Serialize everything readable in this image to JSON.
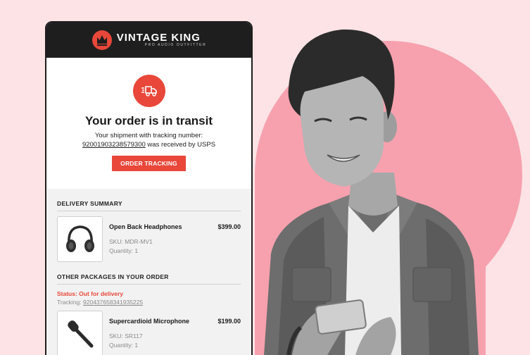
{
  "brand": {
    "name": "VINTAGE KING",
    "tagline": "PRO AUDIO OUTFITTER"
  },
  "hero": {
    "title": "Your order is in transit",
    "line1": "Your shipment with tracking number:",
    "tracking_number": "92001903238579300",
    "line2_suffix": " was received by USPS",
    "cta_label": "ORDER TRACKING"
  },
  "summary": {
    "title": "DELIVERY SUMMARY",
    "item": {
      "name": "Open Back Headphones",
      "price": "$399.00",
      "sku": "SKU: MDR-MV1",
      "quantity": "Quantity: 1",
      "icon": "headphones-icon"
    }
  },
  "other_packages": {
    "title": "OTHER PACKAGES IN YOUR ORDER",
    "status": "Status: Out for delivery",
    "tracking_label": "Tracking: ",
    "tracking_number": "920437658341935225",
    "item": {
      "name": "Supercardioid Microphone",
      "price": "$199.00",
      "sku": "SKU: SR117",
      "quantity": "Quantity: 1",
      "icon": "microphone-icon"
    }
  },
  "colors": {
    "accent": "#e8473a",
    "background": "#fde3e6",
    "circle": "#f7a1ae",
    "header": "#1e1e1e"
  }
}
